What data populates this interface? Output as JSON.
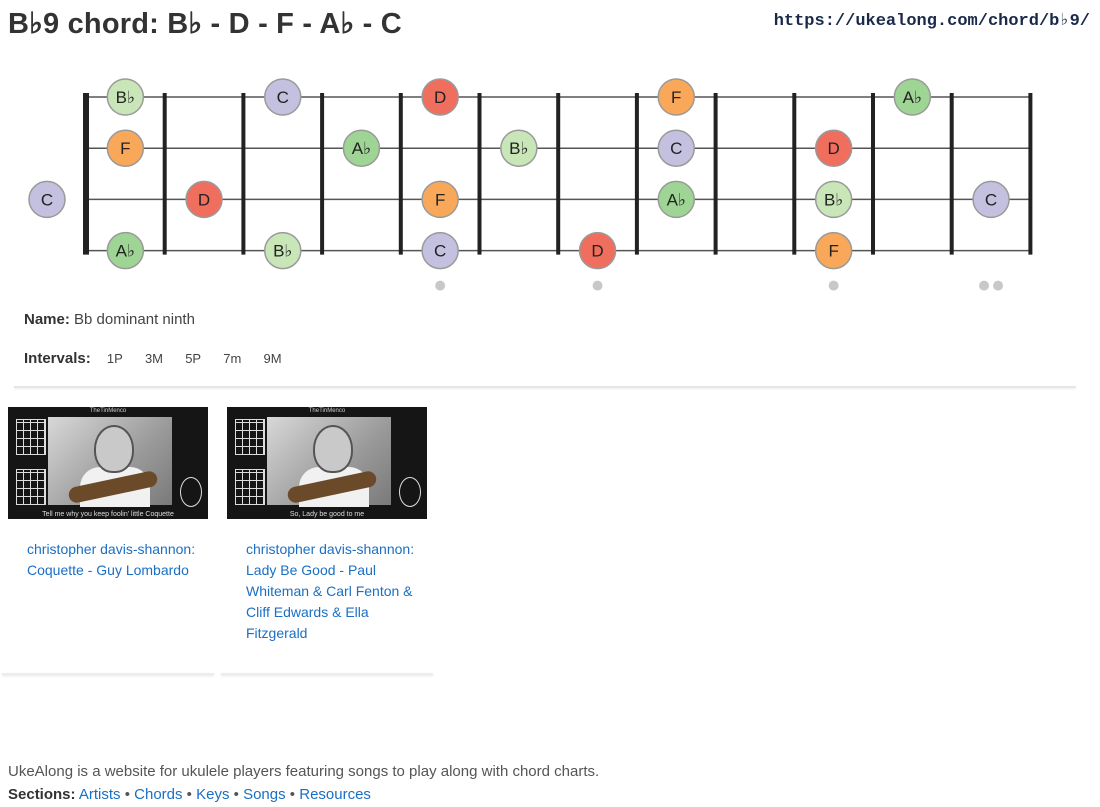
{
  "header": {
    "title": "B♭9 chord: B♭ - D - F - A♭ - C",
    "url": "https://ukealong.com/chord/b♭9/"
  },
  "fretboard": {
    "strings": [
      "A",
      "E",
      "C",
      "G"
    ],
    "frets": 12,
    "inlay_frets": [
      5,
      7,
      10,
      12
    ],
    "note_colors": {
      "B♭": "#c8e6b8",
      "D": "#f06e5e",
      "F": "#f9a85a",
      "A♭": "#9ed494",
      "C": "#c3c0e0"
    },
    "notes": [
      {
        "string": 0,
        "fret": 1,
        "label": "B♭"
      },
      {
        "string": 0,
        "fret": 3,
        "label": "C"
      },
      {
        "string": 0,
        "fret": 5,
        "label": "D"
      },
      {
        "string": 0,
        "fret": 8,
        "label": "F"
      },
      {
        "string": 0,
        "fret": 11,
        "label": "A♭"
      },
      {
        "string": 1,
        "fret": 1,
        "label": "F"
      },
      {
        "string": 1,
        "fret": 4,
        "label": "A♭"
      },
      {
        "string": 1,
        "fret": 6,
        "label": "B♭"
      },
      {
        "string": 1,
        "fret": 8,
        "label": "C"
      },
      {
        "string": 1,
        "fret": 10,
        "label": "D"
      },
      {
        "string": 2,
        "fret": 0,
        "label": "C"
      },
      {
        "string": 2,
        "fret": 2,
        "label": "D"
      },
      {
        "string": 2,
        "fret": 5,
        "label": "F"
      },
      {
        "string": 2,
        "fret": 8,
        "label": "A♭"
      },
      {
        "string": 2,
        "fret": 10,
        "label": "B♭"
      },
      {
        "string": 2,
        "fret": 12,
        "label": "C"
      },
      {
        "string": 3,
        "fret": 1,
        "label": "A♭"
      },
      {
        "string": 3,
        "fret": 3,
        "label": "B♭"
      },
      {
        "string": 3,
        "fret": 5,
        "label": "C"
      },
      {
        "string": 3,
        "fret": 7,
        "label": "D"
      },
      {
        "string": 3,
        "fret": 10,
        "label": "F"
      }
    ]
  },
  "chord_info": {
    "name_label": "Name:",
    "name_value": "Bb dominant ninth",
    "intervals_label": "Intervals:",
    "intervals": [
      "1P",
      "3M",
      "5P",
      "7m",
      "9M"
    ]
  },
  "videos": [
    {
      "thumb_channel": "TheTinMenco",
      "thumb_caption": "Tell me why you keep foolin' little Coquette",
      "title": "christopher davis-shannon: Coquette - Guy Lombardo"
    },
    {
      "thumb_channel": "TheTinMenco",
      "thumb_caption": "So, Lady be good to me",
      "title": "christopher davis-shannon: Lady Be Good - Paul Whiteman & Carl Fenton & Cliff Edwards & Ella Fitzgerald"
    }
  ],
  "footer": {
    "description": "UkeAlong is a website for ukulele players featuring songs to play along with chord charts.",
    "sections_label": "Sections:",
    "sections": [
      "Artists",
      "Chords",
      "Keys",
      "Songs",
      "Resources"
    ],
    "separator": "•"
  }
}
